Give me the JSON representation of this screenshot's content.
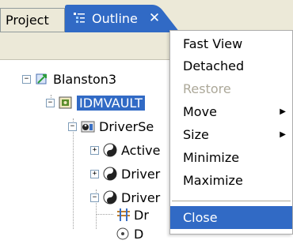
{
  "tabs": {
    "project": "Project",
    "outline": "Outline",
    "close_glyph": "✕"
  },
  "tree": {
    "root": "Blanston3",
    "vault": "IDMVAULT",
    "driverset": "DriverSe",
    "children": [
      {
        "label": "Active",
        "toggle": "+"
      },
      {
        "label": "Driver",
        "toggle": "+"
      },
      {
        "label": "Driver",
        "toggle": "−"
      }
    ],
    "leaf1": "Dr",
    "leaf2": "D"
  },
  "menu": {
    "items": [
      {
        "label": "Fast View"
      },
      {
        "label": "Detached"
      },
      {
        "label": "Restore",
        "disabled": true
      },
      {
        "label": "Move",
        "submenu": true
      },
      {
        "label": "Size",
        "submenu": true
      },
      {
        "label": "Minimize"
      },
      {
        "label": "Maximize"
      },
      {
        "label": "Close",
        "highlighted": true
      }
    ],
    "submenu_arrow": "▶"
  },
  "colors": {
    "selection": "#316ac5",
    "tab_active": "#316ac5",
    "chrome": "#ece9d8",
    "disabled_text": "#aca899"
  }
}
